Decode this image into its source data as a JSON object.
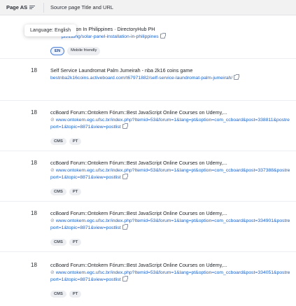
{
  "header": {
    "page_as_label": "Page AS",
    "source_label": "Source page Title and URL"
  },
  "tooltip": {
    "text": "Language: English"
  },
  "rows": [
    {
      "rank": "",
      "title": "stallation In Philippines · DirectoryHub PH",
      "url": "ph/listing/solar-panel-installation-in-philippines",
      "chips": [
        "EN",
        "Mobile friendly"
      ]
    },
    {
      "rank": "18",
      "title": "Self Service Laundromat Palm Jumeirah - nba 2k16 coins game",
      "url": "bestnba2k16coins.activeboard.com/t67971882/self-service-laundromat-palm-jumeirah/",
      "chips": []
    },
    {
      "rank": "18",
      "title": "ccBoard Forum::Ontokem Fórum::Best JavaScript Online Courses on Udemy,...",
      "url": "www.ontokem.egc.ufsc.br/index.php?Itemid=53&forum=1&lang=pt&option=com_ccboard&post=338811&postreport=1&topic=8871&view=postlist",
      "chips": [
        "CMS",
        "PT"
      ]
    },
    {
      "rank": "18",
      "title": "ccBoard Forum::Ontokem Fórum::Best JavaScript Online Courses on Udemy,...",
      "url": "www.ontokem.egc.ufsc.br/index.php?Itemid=53&forum=1&lang=pt&option=com_ccboard&post=337388&postreport=1&topic=8871&view=postlist",
      "chips": [
        "CMS",
        "PT"
      ]
    },
    {
      "rank": "18",
      "title": "ccBoard Forum::Ontokem Fórum::Best JavaScript Online Courses on Udemy,...",
      "url": "www.ontokem.egc.ufsc.br/index.php?Itemid=53&forum=1&lang=pt&option=com_ccboard&post=334901&postreport=1&topic=8871&view=postlist",
      "chips": [
        "CMS",
        "PT"
      ]
    },
    {
      "rank": "18",
      "title": "ccBoard Forum::Ontokem Fórum::Best JavaScript Online Courses on Udemy,...",
      "url": "www.ontokem.egc.ufsc.br/index.php?Itemid=53&forum=1&lang=pt&option=com_ccboard&post=334051&postreport=1&topic=8871&view=postlist",
      "chips": [
        "CMS",
        "PT"
      ]
    }
  ]
}
